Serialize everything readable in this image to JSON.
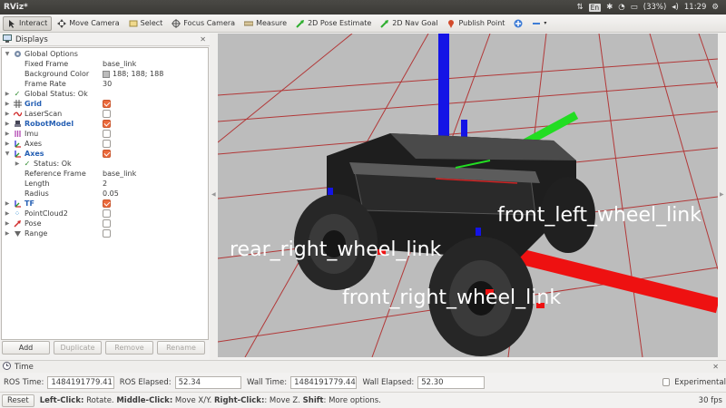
{
  "window": {
    "title": "RViz*"
  },
  "tray": {
    "lang": "En",
    "battery": "(33%)",
    "time": "11:29"
  },
  "toolbar": {
    "items": [
      {
        "label": "Interact"
      },
      {
        "label": "Move Camera"
      },
      {
        "label": "Select"
      },
      {
        "label": "Focus Camera"
      },
      {
        "label": "Measure"
      },
      {
        "label": "2D Pose Estimate"
      },
      {
        "label": "2D Nav Goal"
      },
      {
        "label": "Publish Point"
      }
    ]
  },
  "displays": {
    "title": "Displays",
    "rows": [
      {
        "name": "Global Options"
      },
      {
        "name": "Fixed Frame",
        "value": "base_link"
      },
      {
        "name": "Background Color",
        "value": "188; 188; 188"
      },
      {
        "name": "Frame Rate",
        "value": "30"
      },
      {
        "name": "Global Status: Ok"
      },
      {
        "name": "Grid"
      },
      {
        "name": "LaserScan"
      },
      {
        "name": "RobotModel"
      },
      {
        "name": "Imu"
      },
      {
        "name": "Axes"
      },
      {
        "name": "Axes"
      },
      {
        "name": "Status: Ok"
      },
      {
        "name": "Reference Frame",
        "value": "base_link"
      },
      {
        "name": "Length",
        "value": "2"
      },
      {
        "name": "Radius",
        "value": "0.05"
      },
      {
        "name": "TF"
      },
      {
        "name": "PointCloud2"
      },
      {
        "name": "Pose"
      },
      {
        "name": "Range"
      }
    ],
    "buttons": {
      "add": "Add",
      "duplicate": "Duplicate",
      "remove": "Remove",
      "rename": "Rename"
    }
  },
  "view3d": {
    "labels": {
      "rear_right": "rear_right_wheel_link",
      "front_right": "front_right_wheel_link",
      "front_left": "front_left_wheel_link"
    },
    "background_color": "#bcbcbc",
    "grid_color": "#b03030"
  },
  "time": {
    "title": "Time",
    "ros_time_label": "ROS Time:",
    "ros_time": "1484191779.41",
    "ros_elapsed_label": "ROS Elapsed:",
    "ros_elapsed": "52.34",
    "wall_time_label": "Wall Time:",
    "wall_time": "1484191779.44",
    "wall_elapsed_label": "Wall Elapsed:",
    "wall_elapsed": "52.30",
    "experimental": "Experimental"
  },
  "status": {
    "reset": "Reset",
    "left_click": "Left-Click:",
    "left_click_desc": " Rotate. ",
    "middle_click": "Middle-Click:",
    "middle_click_desc": " Move X/Y. ",
    "right_click": "Right-Click:",
    "right_click_desc": ": Move Z. ",
    "shift": "Shift",
    "shift_desc": ": More options.",
    "fps": "30 fps"
  }
}
